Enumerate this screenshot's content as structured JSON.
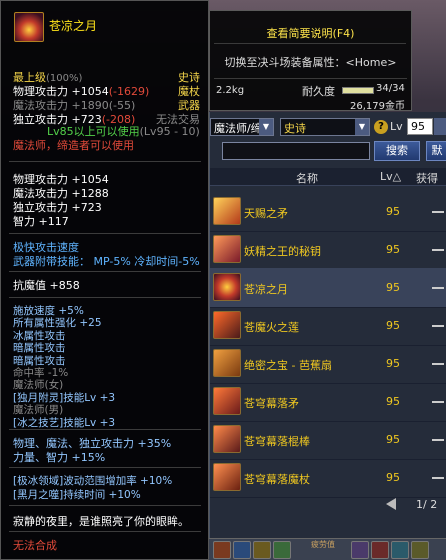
{
  "tooltip": {
    "name": "苍凉之月",
    "top_level": "最上级",
    "top_level_pct": "(100%)",
    "rarity": "史诗",
    "stats_header": [
      {
        "label": "物理攻击力",
        "value": "+1054",
        "delta": "(-1629)"
      },
      {
        "label": "魔法攻击力",
        "value": "+1890",
        "delta": "(-55)"
      },
      {
        "label": "独立攻击力",
        "value": "+723",
        "delta": "(-208)"
      }
    ],
    "type_line1": "魔杖",
    "type_line2": "武器",
    "no_trade": "无法交易",
    "level_req": "Lv85以上可以使用",
    "level_range": "(Lv95 - 10)",
    "class_req": "魔法师，缔造者可以使用",
    "main_stats": [
      "物理攻击力 +1054",
      "魔法攻击力 +1288",
      "独立攻击力 +723",
      "智力 +117"
    ],
    "speed": "极快攻击速度",
    "weapon_skill": "武器附带技能： MP-5% 冷却时间-5%",
    "anti_magic": "抗魔值 +858",
    "bonus": [
      "施放速度 +5%",
      "所有属性强化 +25",
      "冰属性攻击",
      "暗属性攻击",
      "暗属性攻击",
      "命中率 -1%",
      "魔法师(女)",
      "[独月附灵]技能Lv +3",
      "魔法师(男)",
      "[冰之技艺]技能Lv +3"
    ],
    "attack_bonus": "物理、魔法、独立攻击力 +35%",
    "stat_bonus": "力量、智力 +15%",
    "skill_ext": [
      "[极冰领域]波动范围增加率 +10%",
      "[黑月之噬]持续时间 +10%"
    ],
    "flavor": "寂静的夜里，是谁照亮了你的眼眸。",
    "no_synth": "无法合成"
  },
  "compare": {
    "summary_label": "查看简要说明(F4)",
    "switch_label": "切换至决斗场装备属性：<Home>",
    "weight": "2.2kg",
    "durability_label": "耐久度",
    "durability_value": "34/34",
    "durability_fraction": 1.0,
    "gold": "26,179金币"
  },
  "shop": {
    "class_select": "魔法师/缔",
    "rarity_select": "史诗",
    "lv_label": "Lv",
    "lv_value": "95",
    "search_value": "",
    "search_button": "搜索",
    "default_button": "默",
    "col_name": "名称",
    "col_lv": "Lv△",
    "col_obtain": "获得",
    "items": [
      {
        "name": "天赐之矛",
        "lv": "95"
      },
      {
        "name": "妖精之王的秘钥",
        "lv": "95"
      },
      {
        "name": "苍凉之月",
        "lv": "95"
      },
      {
        "name": "苍魔火之莲",
        "lv": "95"
      },
      {
        "name": "绝密之宝 - 芭蕉扇",
        "lv": "95"
      },
      {
        "name": "苍穹幕落矛",
        "lv": "95"
      },
      {
        "name": "苍穹幕落棍棒",
        "lv": "95"
      },
      {
        "name": "苍穹幕落魔杖",
        "lv": "95"
      }
    ],
    "page": "1/ 2"
  },
  "taskbar": {
    "label": "疲劳值"
  },
  "colors": {
    "rarity": "#f5d64a",
    "negative": "#e24a3a",
    "requirement": "#53d14a",
    "bonus": "#93c7ff"
  }
}
